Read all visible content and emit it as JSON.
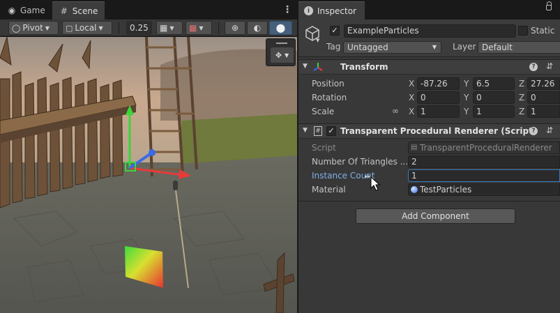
{
  "left_tabs": [
    {
      "label": "Game",
      "icon": "gamepad-icon"
    },
    {
      "label": "Scene",
      "icon": "grid-icon"
    }
  ],
  "scene_toolbar": {
    "pivot_label": "Pivot",
    "local_label": "Local",
    "snap_value": "0.25"
  },
  "inspector": {
    "tab_label": "Inspector",
    "gameobject": {
      "name": "ExampleParticles",
      "active": true,
      "static_label": "Static",
      "static": false,
      "tag_label": "Tag",
      "tag_value": "Untagged",
      "layer_label": "Layer",
      "layer_value": "Default"
    },
    "transform": {
      "title": "Transform",
      "position_label": "Position",
      "rotation_label": "Rotation",
      "scale_label": "Scale",
      "position": {
        "x": "-87.26",
        "y": "6.5",
        "z": "27.26"
      },
      "rotation": {
        "x": "0",
        "y": "0",
        "z": "0"
      },
      "scale": {
        "x": "1",
        "y": "1",
        "z": "1"
      },
      "axis_x": "X",
      "axis_y": "Y",
      "axis_z": "Z"
    },
    "renderer": {
      "title": "Transparent Procedural Renderer (Script)",
      "enabled": true,
      "script_label": "Script",
      "script_value": "TransparentProceduralRenderer",
      "triangles_label": "Number Of Triangles ...",
      "triangles_value": "2",
      "instance_label": "Instance Count",
      "instance_value": "1",
      "material_label": "Material",
      "material_value": "TestParticles"
    },
    "add_component_label": "Add Component"
  },
  "colors": {
    "accent": "#3a79bb",
    "x_axis": "#e83a3a",
    "y_axis": "#3ad63a",
    "z_axis": "#3a6ae8"
  }
}
